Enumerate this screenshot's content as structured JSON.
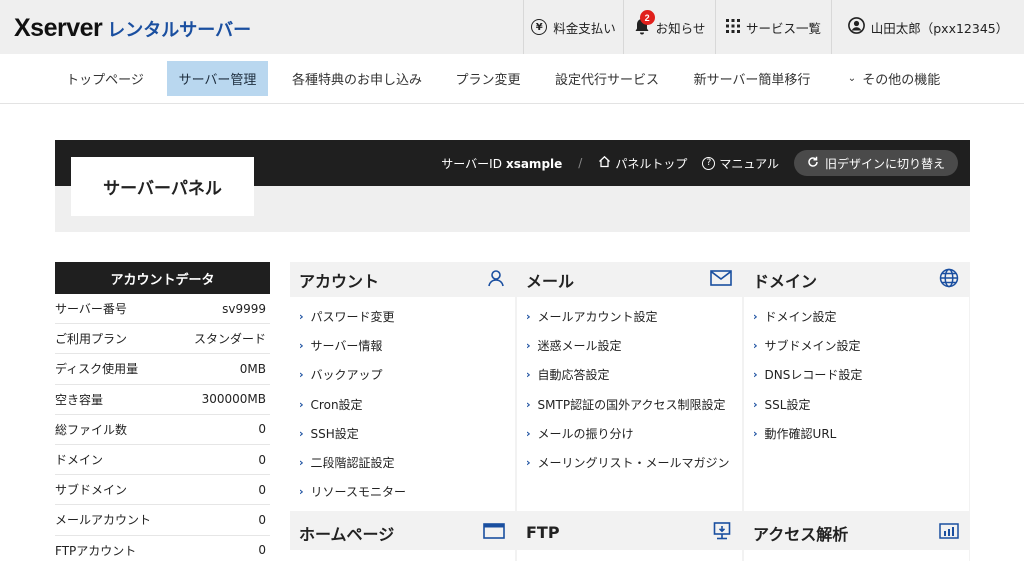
{
  "header": {
    "logo_main": "Xserver",
    "logo_sub": "レンタルサーバー",
    "payment_label": "料金支払い",
    "notice_label": "お知らせ",
    "notice_count": "2",
    "services_label": "サービス一覧",
    "user_label": "山田太郎（pxx12345）"
  },
  "nav": {
    "items": [
      "トップページ",
      "サーバー管理",
      "各種特典のお申し込み",
      "プラン変更",
      "設定代行サービス",
      "新サーバー簡単移行",
      "その他の機能"
    ],
    "active": "サーバー管理"
  },
  "panel": {
    "title": "サーバーパネル",
    "server_id_label": "サーバーID",
    "server_id_value": "xsample",
    "separator": "/",
    "top_link": "パネルトップ",
    "manual_link": "マニュアル",
    "old_design_button": "旧デザインに切り替え"
  },
  "account": {
    "title": "アカウントデータ",
    "rows": [
      {
        "label": "サーバー番号",
        "value": "sv9999"
      },
      {
        "label": "ご利用プラン",
        "value": "スタンダード"
      },
      {
        "label": "ディスク使用量",
        "value": "0MB"
      },
      {
        "label": "空き容量",
        "value": "300000MB"
      },
      {
        "label": "総ファイル数",
        "value": "0"
      },
      {
        "label": "ドメイン",
        "value": "0"
      },
      {
        "label": "サブドメイン",
        "value": "0"
      },
      {
        "label": "メールアカウント",
        "value": "0"
      },
      {
        "label": "FTPアカウント",
        "value": "0"
      }
    ]
  },
  "sections": {
    "account": {
      "title": "アカウント",
      "icon": "user-icon",
      "links": [
        "パスワード変更",
        "サーバー情報",
        "バックアップ",
        "Cron設定",
        "SSH設定",
        "二段階認証設定",
        "リソースモニター"
      ]
    },
    "mail": {
      "title": "メール",
      "icon": "mail-icon",
      "links": [
        "メールアカウント設定",
        "迷惑メール設定",
        "自動応答設定",
        "SMTP認証の国外アクセス制限設定",
        "メールの振り分け",
        "メーリングリスト・メールマガジン"
      ]
    },
    "domain": {
      "title": "ドメイン",
      "icon": "globe-icon",
      "links": [
        "ドメイン設定",
        "サブドメイン設定",
        "DNSレコード設定",
        "SSL設定",
        "動作確認URL"
      ]
    },
    "homepage": {
      "title": "ホームページ",
      "icon": "browser-window-icon"
    },
    "ftp": {
      "title": "FTP",
      "icon": "monitor-icon"
    },
    "analytics": {
      "title": "アクセス解析",
      "icon": "bar-chart-icon"
    }
  },
  "colors": {
    "accent_blue": "#1a4fa0",
    "nav_active_bg": "#b9d7ef",
    "dark_bar": "#1f1f1f",
    "badge_red": "#e0201c"
  }
}
